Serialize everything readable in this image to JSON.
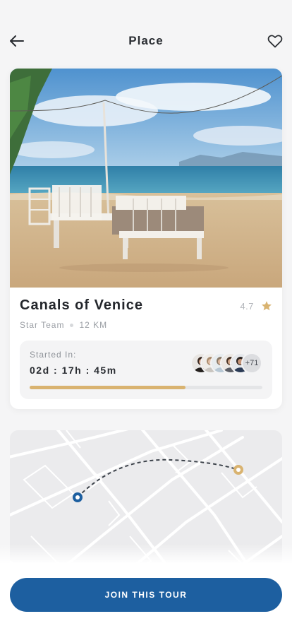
{
  "header": {
    "title": "Place",
    "back_icon": "arrow-left-icon",
    "favorite_icon": "heart-icon"
  },
  "place": {
    "name": "Canals of Venice",
    "rating": "4.7",
    "rating_icon": "star-icon",
    "team": "Star Team",
    "distance": "12 KM",
    "photo_subject": "beach-with-white-bench-and-table"
  },
  "countdown": {
    "label": "Started In:",
    "time": "02d : 17h : 45m",
    "progress": 0.67,
    "extra_participants": "+71"
  },
  "map": {
    "start_marker": "blue",
    "end_marker": "gold"
  },
  "cta": {
    "label": "JOIN THIS TOUR"
  },
  "colors": {
    "primary": "#1d5fa0",
    "accent_gold": "#d9b370",
    "star": "#d9b370",
    "background": "#f5f5f6"
  }
}
